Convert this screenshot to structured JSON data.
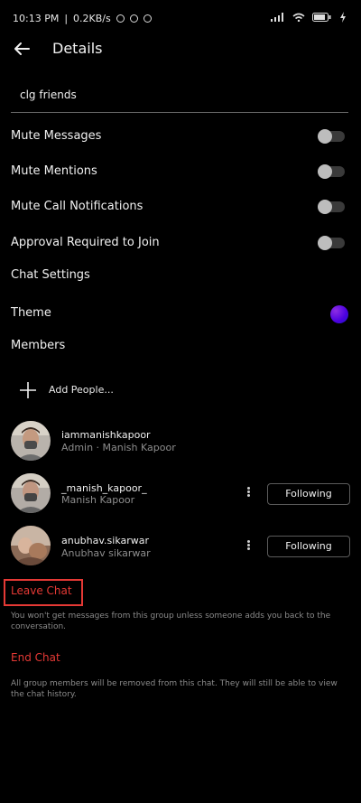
{
  "status_bar": {
    "time": "10:13 PM",
    "network_speed": "0.2KB/s"
  },
  "header": {
    "title": "Details",
    "back_icon": "arrow-left-icon"
  },
  "group_name": "clg friends",
  "settings": {
    "mute_messages": "Mute Messages",
    "mute_mentions": "Mute Mentions",
    "mute_call_notifications": "Mute Call Notifications",
    "approval_required": "Approval Required to Join",
    "chat_settings": "Chat Settings",
    "theme": "Theme",
    "members": "Members"
  },
  "add_people": "Add People...",
  "members": [
    {
      "username": "iammanishkapoor",
      "subtext": "Admin · Manish Kapoor"
    },
    {
      "username": "_manish_kapoor_",
      "subtext": "Manish Kapoor",
      "button": "Following"
    },
    {
      "username": "anubhav.sikarwar",
      "subtext": "Anubhav sikarwar",
      "button": "Following"
    }
  ],
  "leave_chat": {
    "label": "Leave Chat",
    "description": "You won't get messages from this group unless someone adds you back to the conversation."
  },
  "end_chat": {
    "label": "End Chat",
    "description": "All group members will be removed from this chat. They will still be able to view the chat history."
  },
  "colors": {
    "background": "#000000",
    "danger": "#e53935",
    "toggle_off": "#3a3a3a",
    "theme_accent": "#4a00e0"
  }
}
